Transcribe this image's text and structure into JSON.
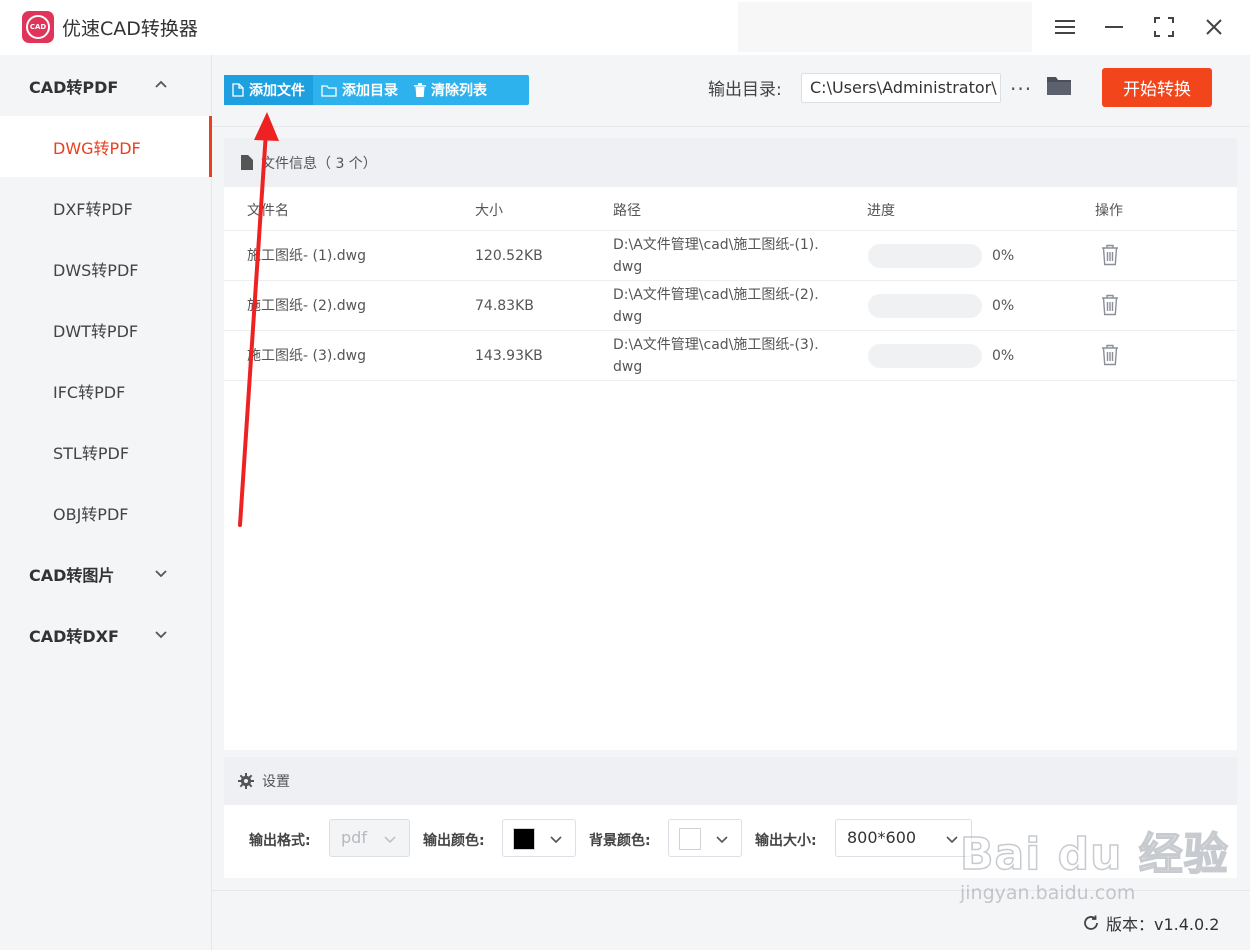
{
  "app": {
    "title": "优速CAD转换器",
    "logo_text": "CAD"
  },
  "sidebar": {
    "groups": [
      {
        "label": "CAD转PDF",
        "expanded": true
      },
      {
        "label": "CAD转图片",
        "expanded": false
      },
      {
        "label": "CAD转DXF",
        "expanded": false
      }
    ],
    "items": [
      {
        "label": "DWG转PDF",
        "active": true
      },
      {
        "label": "DXF转PDF"
      },
      {
        "label": "DWS转PDF"
      },
      {
        "label": "DWT转PDF"
      },
      {
        "label": "IFC转PDF"
      },
      {
        "label": "STL转PDF"
      },
      {
        "label": "OBJ转PDF"
      }
    ]
  },
  "toolbar": {
    "add_file": "添加文件",
    "add_folder": "添加目录",
    "clear_list": "清除列表",
    "output_label": "输出目录:",
    "output_path": "C:\\Users\\Administrator\\",
    "more": "···",
    "start": "开始转换"
  },
  "files": {
    "header_title": "文件信息（ 3 个）",
    "columns": {
      "name": "文件名",
      "size": "大小",
      "path": "路径",
      "progress": "进度",
      "action": "操作"
    },
    "rows": [
      {
        "name": "施工图纸- (1).dwg",
        "size": "120.52KB",
        "path": "D:\\A文件管理\\cad\\施工图纸-(1).dwg",
        "progress_label": "0%",
        "progress": 0
      },
      {
        "name": "施工图纸- (2).dwg",
        "size": "74.83KB",
        "path": "D:\\A文件管理\\cad\\施工图纸-(2).dwg",
        "progress_label": "0%",
        "progress": 0
      },
      {
        "name": "施工图纸- (3).dwg",
        "size": "143.93KB",
        "path": "D:\\A文件管理\\cad\\施工图纸-(3).dwg",
        "progress_label": "0%",
        "progress": 0
      }
    ]
  },
  "settings": {
    "title": "设置",
    "format_label": "输出格式:",
    "format_value": "pdf",
    "color_label": "输出颜色:",
    "color_value": "#000000",
    "bg_label": "背景颜色:",
    "bg_value": "#ffffff",
    "size_label": "输出大小:",
    "size_value": "800*600"
  },
  "footer": {
    "version": "版本：v1.4.0.2"
  },
  "watermark": {
    "logo": "Bai du 经验",
    "sub": "jingyan.baidu.com"
  },
  "colors": {
    "accent": "#2db2ee",
    "primary": "#f2451c",
    "active_nav": "#e8411f",
    "arrow": "#ee2222"
  }
}
